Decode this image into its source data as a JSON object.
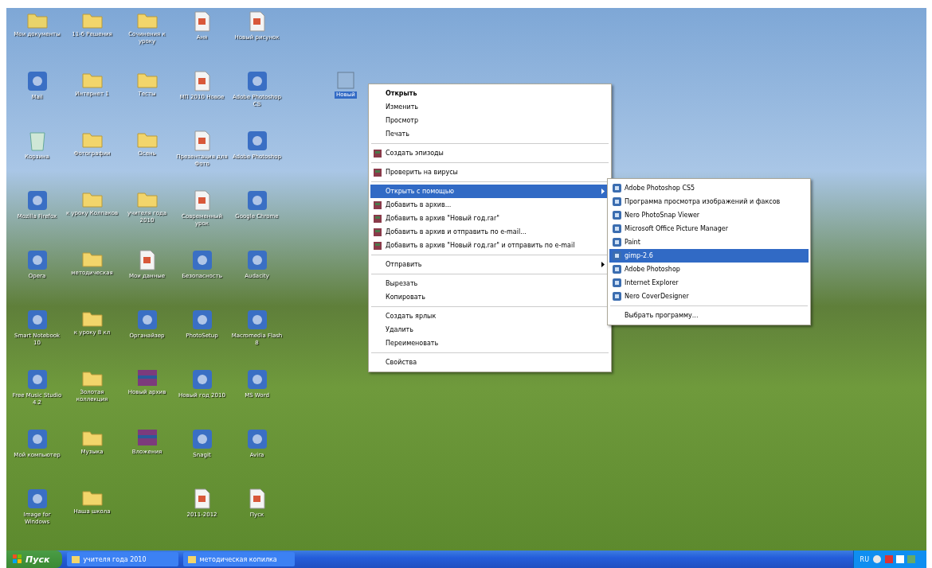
{
  "desktop": {
    "columns": [
      [
        {
          "label": "Мои документы",
          "kind": "docs"
        },
        {
          "label": "Mail",
          "kind": "app"
        },
        {
          "label": "Корзина",
          "kind": "bin"
        },
        {
          "label": "Mozilla Firefox",
          "kind": "app"
        },
        {
          "label": "Opera",
          "kind": "app"
        },
        {
          "label": "Smart Notebook 10",
          "kind": "app"
        },
        {
          "label": "Free Music Studio 4.2",
          "kind": "app"
        },
        {
          "label": "Мой компьютер",
          "kind": "app"
        },
        {
          "label": "Image for Windows",
          "kind": "app"
        }
      ],
      [
        {
          "label": "11-б Решения",
          "kind": "folder"
        },
        {
          "label": "Интернет 1",
          "kind": "folder"
        },
        {
          "label": "Фотографии",
          "kind": "folder"
        },
        {
          "label": "к уроку Колпаков",
          "kind": "folder"
        },
        {
          "label": "методическая",
          "kind": "folder"
        },
        {
          "label": "к уроку 8 кл",
          "kind": "folder"
        },
        {
          "label": "Золотая коллекция",
          "kind": "folder"
        },
        {
          "label": "Музыка",
          "kind": "folder"
        },
        {
          "label": "Наша школа",
          "kind": "folder"
        }
      ],
      [
        {
          "label": "Сочинения к уроку",
          "kind": "folder"
        },
        {
          "label": "Тесты",
          "kind": "folder"
        },
        {
          "label": "Осень",
          "kind": "folder"
        },
        {
          "label": "учителя года 2010",
          "kind": "folder"
        },
        {
          "label": "Мои данные",
          "kind": "file"
        },
        {
          "label": "Органайзер",
          "kind": "app"
        },
        {
          "label": "Новый архив",
          "kind": "archive"
        },
        {
          "label": "Вложения",
          "kind": "archive"
        }
      ],
      [
        {
          "label": "Аня",
          "kind": "file"
        },
        {
          "label": "МП 2010 Новое",
          "kind": "file"
        },
        {
          "label": "Презентация для Фото",
          "kind": "file"
        },
        {
          "label": "Современный урок",
          "kind": "file"
        },
        {
          "label": "Безопасность",
          "kind": "app"
        },
        {
          "label": "PhotoSetup",
          "kind": "app"
        },
        {
          "label": "Новый год 2010",
          "kind": "app"
        },
        {
          "label": "Snagit",
          "kind": "app"
        },
        {
          "label": "2011-2012",
          "kind": "file"
        }
      ],
      [
        {
          "label": "Новый рисунок",
          "kind": "file"
        },
        {
          "label": "Adobe Photoshop CS",
          "kind": "app"
        },
        {
          "label": "Adobe Photoshop",
          "kind": "app"
        },
        {
          "label": "Google Chrome",
          "kind": "app"
        },
        {
          "label": "Audacity",
          "kind": "app"
        },
        {
          "label": "Macromedia Flash 8",
          "kind": "app"
        },
        {
          "label": "MS Word",
          "kind": "app"
        },
        {
          "label": "Avira",
          "kind": "app"
        },
        {
          "label": "Пуск",
          "kind": "file"
        }
      ]
    ],
    "selected_icon": {
      "label": "Новый",
      "selected": true
    }
  },
  "context_menu": {
    "items": [
      {
        "kind": "default",
        "label": "Открыть",
        "selected": false
      },
      {
        "kind": "plain",
        "label": "Изменить",
        "selected": false
      },
      {
        "kind": "plain",
        "label": "Просмотр",
        "selected": false
      },
      {
        "kind": "plain",
        "label": "Печать",
        "selected": false
      },
      {
        "kind": "separator"
      },
      {
        "kind": "icon",
        "label": "Создать эпизоды",
        "selected": false
      },
      {
        "kind": "separator"
      },
      {
        "kind": "icon",
        "label": "Проверить на вирусы",
        "selected": false
      },
      {
        "kind": "separator"
      },
      {
        "kind": "submenu",
        "label": "Открыть с помощью",
        "selected": true
      },
      {
        "kind": "icon",
        "label": "Добавить в архив...",
        "selected": false
      },
      {
        "kind": "icon",
        "label": "Добавить в архив \"Новый год.rar\"",
        "selected": false
      },
      {
        "kind": "icon",
        "label": "Добавить в архив и отправить по e-mail...",
        "selected": false
      },
      {
        "kind": "icon",
        "label": "Добавить в архив \"Новый год.rar\" и отправить по e-mail",
        "selected": false
      },
      {
        "kind": "separator"
      },
      {
        "kind": "submenu",
        "label": "Отправить",
        "selected": false
      },
      {
        "kind": "separator"
      },
      {
        "kind": "plain",
        "label": "Вырезать",
        "selected": false
      },
      {
        "kind": "plain",
        "label": "Копировать",
        "selected": false
      },
      {
        "kind": "separator"
      },
      {
        "kind": "plain",
        "label": "Создать ярлык",
        "selected": false
      },
      {
        "kind": "plain",
        "label": "Удалить",
        "selected": false
      },
      {
        "kind": "plain",
        "label": "Переименовать",
        "selected": false
      },
      {
        "kind": "separator"
      },
      {
        "kind": "plain",
        "label": "Свойства",
        "selected": false
      }
    ]
  },
  "submenu": {
    "items": [
      {
        "kind": "icon",
        "label": "Adobe Photoshop CS5",
        "selected": false
      },
      {
        "kind": "icon",
        "label": "Программа просмотра изображений и факсов",
        "selected": false
      },
      {
        "kind": "icon",
        "label": "Nero PhotoSnap Viewer",
        "selected": false
      },
      {
        "kind": "icon",
        "label": "Microsoft Office Picture Manager",
        "selected": false
      },
      {
        "kind": "icon",
        "label": "Paint",
        "selected": false
      },
      {
        "kind": "icon",
        "label": "gimp-2.6",
        "selected": true
      },
      {
        "kind": "icon",
        "label": "Adobe Photoshop",
        "selected": false
      },
      {
        "kind": "icon",
        "label": "Internet Explorer",
        "selected": false
      },
      {
        "kind": "icon",
        "label": "Nero CoverDesigner",
        "selected": false
      },
      {
        "kind": "separator"
      },
      {
        "kind": "plain",
        "label": "Выбрать программу...",
        "selected": false
      }
    ]
  },
  "taskbar": {
    "start": "Пуск",
    "tasks": [
      {
        "label": "учителя года 2010",
        "selected": false
      },
      {
        "label": "методическая копилка",
        "selected": false
      }
    ],
    "language": "RU"
  }
}
